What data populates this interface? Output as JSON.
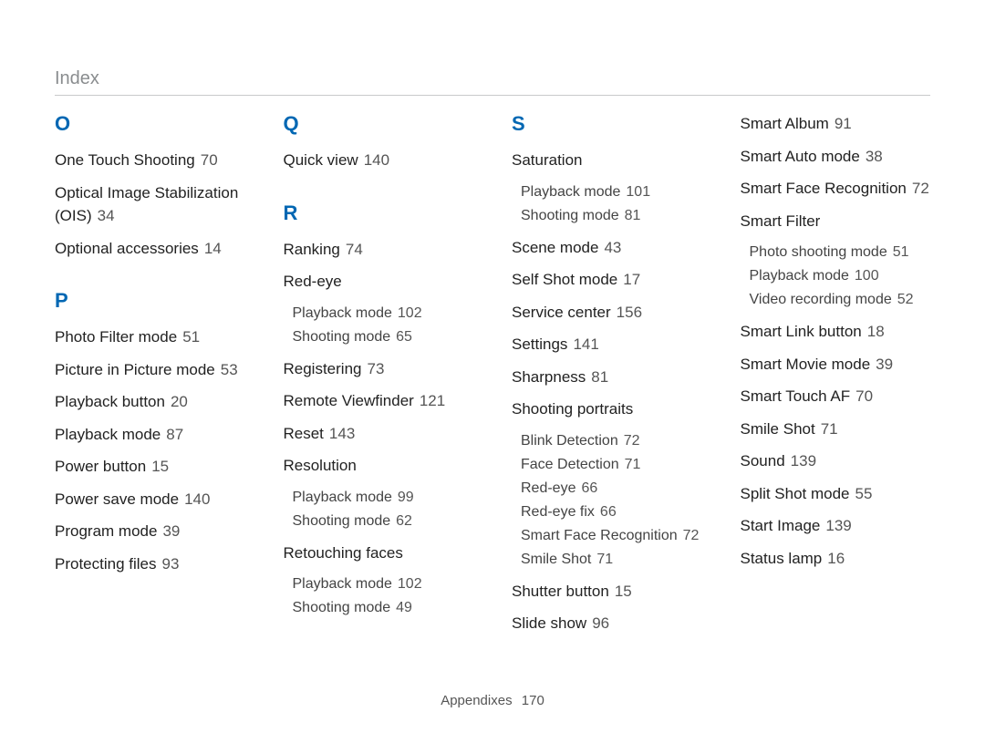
{
  "header_title": "Index",
  "footer_section": "Appendixes",
  "footer_page": "170",
  "columns": [
    {
      "blocks": [
        {
          "letter": "O",
          "entries": [
            {
              "term": "One Touch Shooting",
              "page": "70"
            },
            {
              "term": "Optical Image Stabilization (OIS)",
              "page": "34"
            },
            {
              "term": "Optional accessories",
              "page": "14"
            }
          ]
        },
        {
          "letter": "P",
          "entries": [
            {
              "term": "Photo Filter mode",
              "page": "51"
            },
            {
              "term": "Picture in Picture mode",
              "page": "53"
            },
            {
              "term": "Playback button",
              "page": "20"
            },
            {
              "term": "Playback mode",
              "page": "87"
            },
            {
              "term": "Power button",
              "page": "15"
            },
            {
              "term": "Power save mode",
              "page": "140"
            },
            {
              "term": "Program mode",
              "page": "39"
            },
            {
              "term": "Protecting files",
              "page": "93"
            }
          ]
        }
      ]
    },
    {
      "blocks": [
        {
          "letter": "Q",
          "entries": [
            {
              "term": "Quick view",
              "page": "140"
            }
          ]
        },
        {
          "letter": "R",
          "entries": [
            {
              "term": "Ranking",
              "page": "74"
            },
            {
              "term": "Red-eye",
              "subs": [
                {
                  "term": "Playback mode",
                  "page": "102"
                },
                {
                  "term": "Shooting mode",
                  "page": "65"
                }
              ]
            },
            {
              "term": "Registering",
              "page": "73"
            },
            {
              "term": "Remote Viewfinder",
              "page": "121"
            },
            {
              "term": "Reset",
              "page": "143"
            },
            {
              "term": "Resolution",
              "subs": [
                {
                  "term": "Playback mode",
                  "page": "99"
                },
                {
                  "term": "Shooting mode",
                  "page": "62"
                }
              ]
            },
            {
              "term": "Retouching faces",
              "subs": [
                {
                  "term": "Playback mode",
                  "page": "102"
                },
                {
                  "term": "Shooting mode",
                  "page": "49"
                }
              ]
            }
          ]
        }
      ]
    },
    {
      "blocks": [
        {
          "letter": "S",
          "entries": [
            {
              "term": "Saturation",
              "subs": [
                {
                  "term": "Playback mode",
                  "page": "101"
                },
                {
                  "term": "Shooting mode",
                  "page": "81"
                }
              ]
            },
            {
              "term": "Scene mode",
              "page": "43"
            },
            {
              "term": "Self Shot mode",
              "page": "17"
            },
            {
              "term": "Service center",
              "page": "156"
            },
            {
              "term": "Settings",
              "page": "141"
            },
            {
              "term": "Sharpness",
              "page": "81"
            },
            {
              "term": "Shooting portraits",
              "subs": [
                {
                  "term": "Blink Detection",
                  "page": "72"
                },
                {
                  "term": "Face Detection",
                  "page": "71"
                },
                {
                  "term": "Red-eye",
                  "page": "66"
                },
                {
                  "term": "Red-eye fix",
                  "page": "66"
                },
                {
                  "term": "Smart Face Recognition",
                  "page": "72"
                },
                {
                  "term": "Smile Shot",
                  "page": "71"
                }
              ]
            },
            {
              "term": "Shutter button",
              "page": "15"
            },
            {
              "term": "Slide show",
              "page": "96"
            }
          ]
        }
      ]
    },
    {
      "blocks": [
        {
          "entries": [
            {
              "term": "Smart Album",
              "page": "91"
            },
            {
              "term": "Smart Auto mode",
              "page": "38"
            },
            {
              "term": "Smart Face Recognition",
              "page": "72"
            },
            {
              "term": "Smart Filter",
              "subs": [
                {
                  "term": "Photo shooting mode",
                  "page": "51"
                },
                {
                  "term": "Playback mode",
                  "page": "100"
                },
                {
                  "term": "Video recording mode",
                  "page": "52"
                }
              ]
            },
            {
              "term": "Smart Link button",
              "page": "18"
            },
            {
              "term": "Smart Movie mode",
              "page": "39"
            },
            {
              "term": "Smart Touch AF",
              "page": "70"
            },
            {
              "term": "Smile Shot",
              "page": "71"
            },
            {
              "term": "Sound",
              "page": "139"
            },
            {
              "term": "Split Shot mode",
              "page": "55"
            },
            {
              "term": "Start Image",
              "page": "139"
            },
            {
              "term": "Status lamp",
              "page": "16"
            }
          ]
        }
      ]
    }
  ]
}
